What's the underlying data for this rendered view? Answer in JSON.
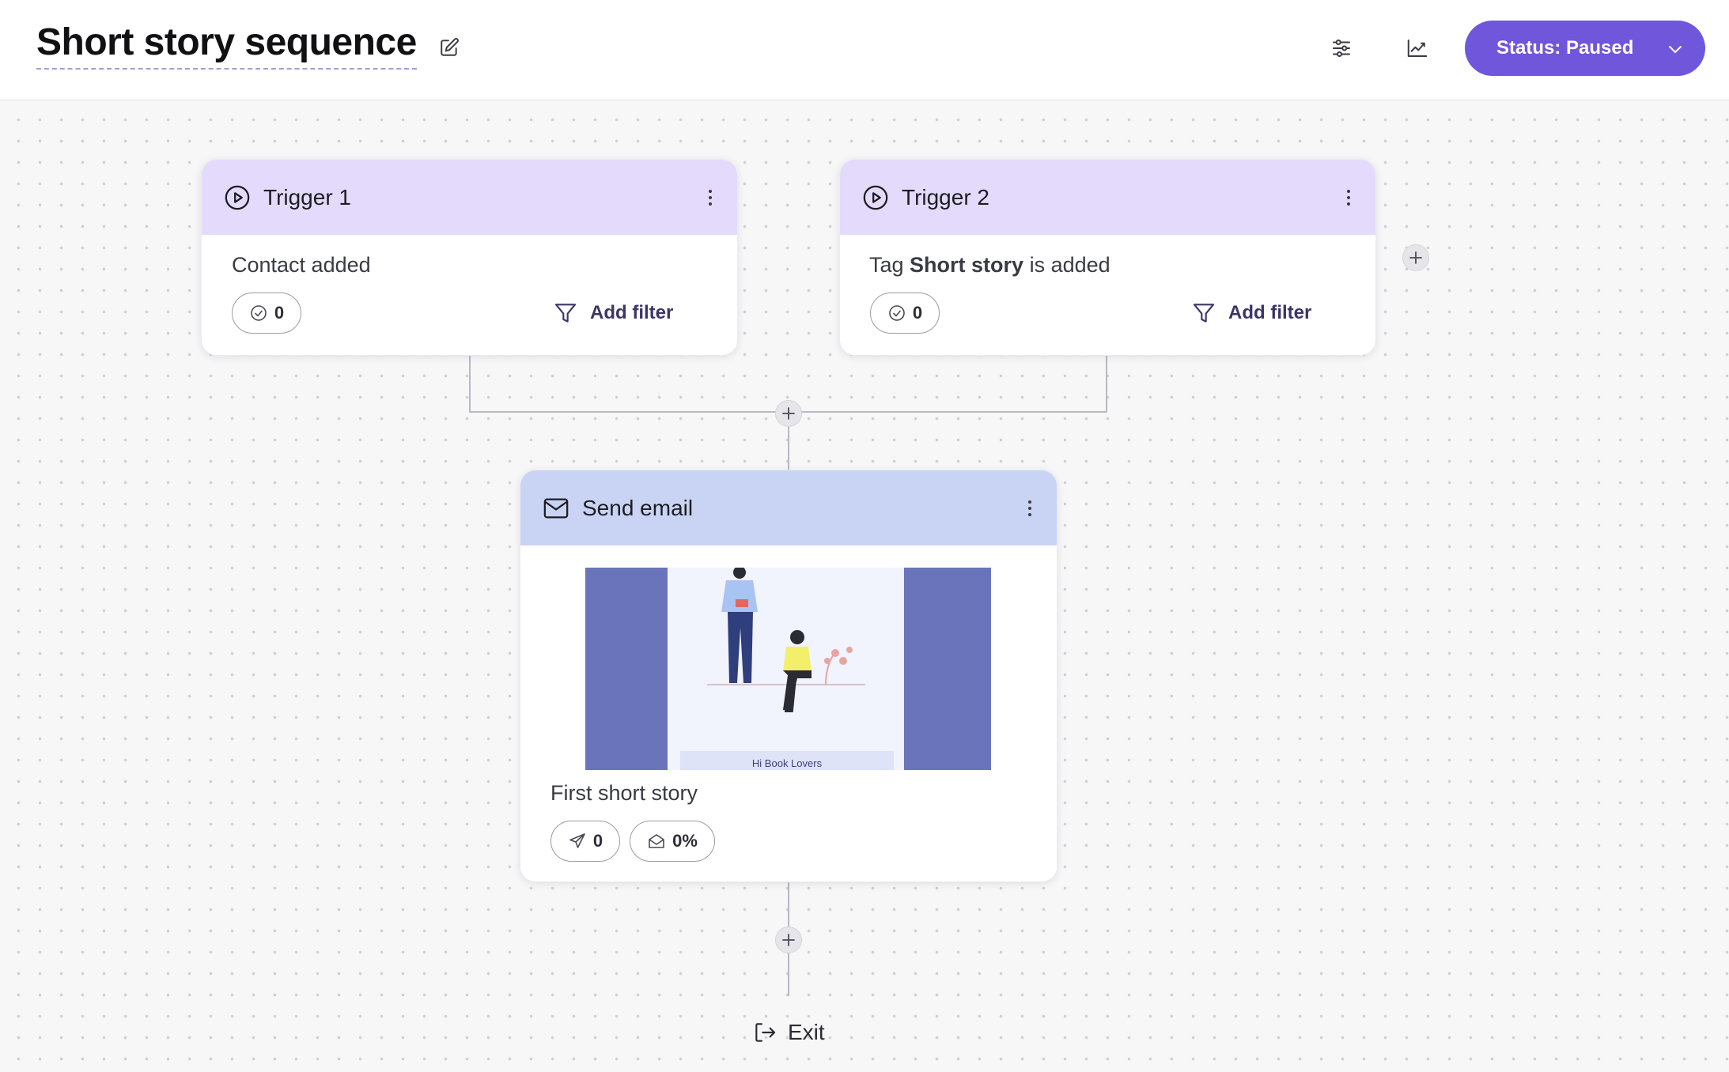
{
  "header": {
    "title": "Short story sequence",
    "status_label": "Status: Paused"
  },
  "triggers": [
    {
      "title": "Trigger 1",
      "description": "Contact added",
      "count": "0",
      "filter_label": "Add filter"
    },
    {
      "title": "Trigger 2",
      "description_prefix": "Tag ",
      "description_bold": "Short story",
      "description_suffix": " is added",
      "count": "0",
      "filter_label": "Add filter"
    }
  ],
  "email": {
    "title": "Send email",
    "preview_banner": "Hi Book Lovers",
    "subject": "First short story",
    "sent_count": "0",
    "open_rate": "0%"
  },
  "exit_label": "Exit",
  "colors": {
    "accent": "#6f56db",
    "trigger_header": "#e4dafc",
    "email_header": "#c9d4f5"
  }
}
